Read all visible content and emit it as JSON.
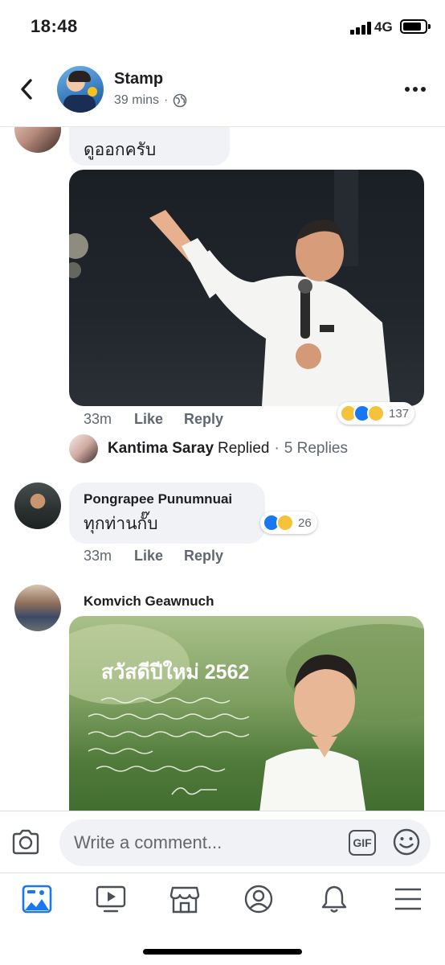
{
  "status_bar": {
    "time": "18:48",
    "network": "4G"
  },
  "header": {
    "name": "Stamp",
    "time": "39 mins",
    "separator": "·"
  },
  "comments": [
    {
      "name": "",
      "text": "ดูออกครับ"
    },
    {
      "actions": {
        "time": "33m",
        "like": "Like",
        "reply": "Reply"
      },
      "reactions": {
        "icons": [
          "haha",
          "like",
          "sad"
        ],
        "count": "137"
      },
      "replies": {
        "name": "Kantima Saray",
        "verb": "Replied",
        "dot": "·",
        "count_text": "5 Replies"
      }
    },
    {
      "name": "Pongrapee Punumnuai",
      "text": "ทุกท่านกั๊บ",
      "actions": {
        "time": "33m",
        "like": "Like",
        "reply": "Reply"
      },
      "reactions": {
        "icons": [
          "like",
          "haha"
        ],
        "count": "26"
      }
    },
    {
      "name": "Komvich Geawnuch",
      "photo_text": "สวัสดีปีใหม่ 2562"
    }
  ],
  "composer": {
    "placeholder": "Write a comment...",
    "gif_label": "GIF"
  },
  "tabs": [
    "news-feed",
    "watch",
    "marketplace",
    "profile",
    "notifications",
    "menu"
  ],
  "colors": {
    "accent": "#1877f2",
    "bubble": "#f0f2f5",
    "meta": "#606770"
  }
}
